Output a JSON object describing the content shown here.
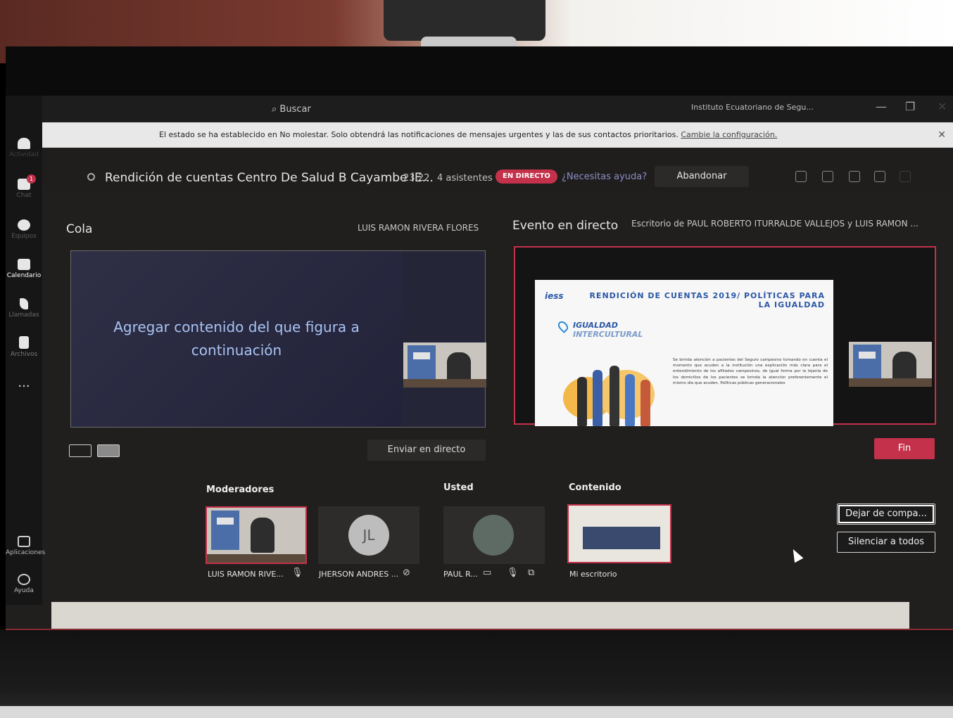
{
  "window": {
    "search_label": "Buscar",
    "org_name": "Instituto Ecuatoriano de Segu...",
    "minimize": "—",
    "maximize": "❐",
    "close": "✕"
  },
  "rail": {
    "items": [
      {
        "label": "Actividad",
        "icon": "bell-icon"
      },
      {
        "label": "Chat",
        "icon": "chat-icon",
        "badge": "1"
      },
      {
        "label": "Equipos",
        "icon": "teams-icon"
      },
      {
        "label": "Calendario",
        "icon": "calendar-icon"
      },
      {
        "label": "Llamadas",
        "icon": "phone-icon"
      },
      {
        "label": "Archivos",
        "icon": "file-icon"
      },
      {
        "label": "...",
        "icon": "more-icon"
      },
      {
        "label": "Aplicaciones",
        "icon": "apps-icon"
      },
      {
        "label": "Ayuda",
        "icon": "help-icon"
      }
    ]
  },
  "notification": {
    "text": "El estado se ha establecido en No molestar. Solo obtendrá las notificaciones de mensajes urgentes y las de sus contactos prioritarios.",
    "link": "Cambie la configuración.",
    "close": "✕"
  },
  "meeting": {
    "title": "Rendición de cuentas Centro De Salud B Cayambe IE...",
    "timer": "23:22",
    "attendees": "4 asistentes",
    "live_badge": "EN DIRECTO",
    "help_link": "¿Necesitas ayuda?",
    "leave_label": "Abandonar"
  },
  "queue": {
    "label": "Cola",
    "presenter": "LUIS RAMON RIVERA FLORES",
    "placeholder": "Agregar contenido del que figura a continuación",
    "send_live": "Enviar en directo"
  },
  "live_event": {
    "label": "Evento en directo",
    "source": "Escritorio de PAUL ROBERTO ITURRALDE VALLEJOS y LUIS RAMON ...",
    "end_label": "Fin",
    "slide": {
      "logo": "iess",
      "title": "RENDICIÓN DE CUENTAS 2019/ POLÍTICAS PARA LA IGUALDAD",
      "subtitle_1": "IGUALDAD",
      "subtitle_2": "INTERCULTURAL",
      "body": "Se brinda atención a pacientes del Seguro campesino tomando en cuenta el momento que acuden a la institución una explicación más clara para el entendimiento de los afiliados campesinos, de igual forma por la lejanía de los domicilios de los pacientes se brinda la atención preferentemente el mismo día que acuden. Políticas públicas generacionales"
    }
  },
  "participants": {
    "moderators_label": "Moderadores",
    "you_label": "Usted",
    "content_label": "Contenido",
    "moderators": [
      {
        "name": "LUIS RAMON RIVE...",
        "has_video": true
      },
      {
        "name": "JHERSON ANDRES ...",
        "initials": "JL",
        "has_video": false
      }
    ],
    "you": {
      "name": "PAUL R..."
    },
    "content": {
      "name": "Mi escritorio"
    }
  },
  "actions": {
    "stop_sharing": "Dejar de compa...",
    "mute_all": "Silenciar a todos"
  },
  "colors": {
    "accent_live": "#c4314b",
    "link": "#8b8cc7",
    "placeholder_text": "#a8c4f2"
  }
}
